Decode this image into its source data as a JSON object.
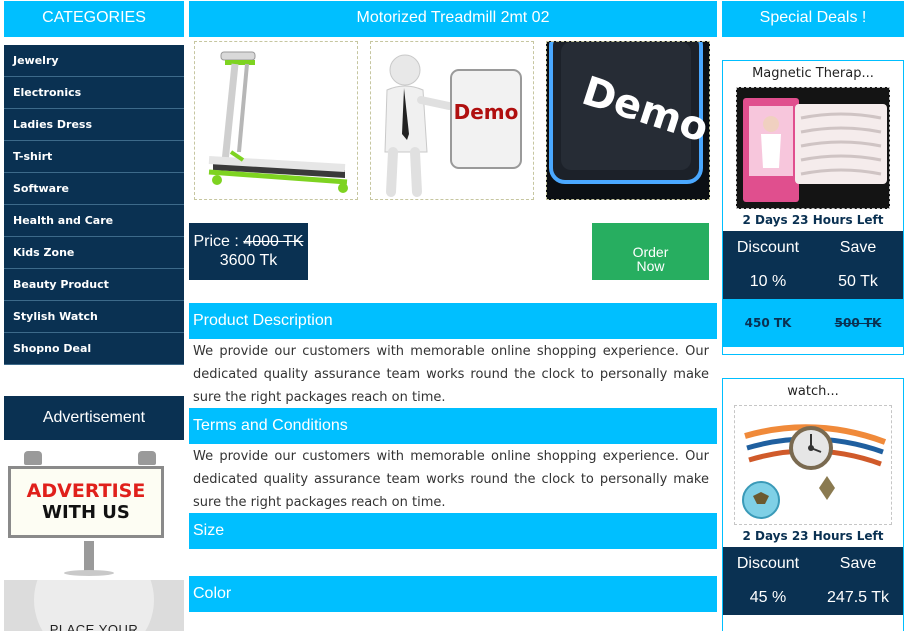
{
  "categories": {
    "title": "CATEGORIES",
    "items": [
      {
        "label": "Jewelry"
      },
      {
        "label": "Electronics"
      },
      {
        "label": "Ladies Dress"
      },
      {
        "label": "T-shirt"
      },
      {
        "label": "Software"
      },
      {
        "label": "Health and Care"
      },
      {
        "label": "Kids Zone"
      },
      {
        "label": "Beauty Product"
      },
      {
        "label": "Stylish Watch"
      },
      {
        "label": "Shopno Deal"
      }
    ]
  },
  "advertisement": {
    "title": "Advertisement",
    "board_line1": "ADVERTISE",
    "board_line2": "WITH US",
    "place_text": "PLACE YOUR"
  },
  "product": {
    "title": "Motorized Treadmill 2mt 02",
    "demo_label_1": "Demo",
    "demo_label_2": "Demo",
    "price_label": "Price :",
    "old_price": "4000 TK",
    "new_price": "3600 Tk",
    "order_line1": "Order",
    "order_line2": "Now"
  },
  "sections": {
    "description_title": "Product Description",
    "description_text": "We provide our customers with memorable online shopping experience. Our dedicated quality assurance team works round the clock to personally make sure the right packages reach on time.",
    "terms_title": "Terms and Conditions",
    "terms_text": "We provide our customers with memorable online shopping experience. Our dedicated quality assurance team works round the clock to personally make sure the right packages reach on time.",
    "size_title": "Size",
    "color_title": "Color"
  },
  "deals": {
    "title": "Special Deals !",
    "items": [
      {
        "name": "Magnetic Therap...",
        "timer": "2 Days 23 Hours Left",
        "discount_label": "Discount",
        "save_label": "Save",
        "discount": "10 %",
        "save": "50 Tk",
        "new_price": "450 TK",
        "old_price": "500 TK"
      },
      {
        "name": "watch...",
        "timer": "2 Days 23 Hours Left",
        "discount_label": "Discount",
        "save_label": "Save",
        "discount": "45 %",
        "save": "247.5 Tk"
      }
    ]
  },
  "colors": {
    "accent": "#00bfff",
    "navy": "#0a3152",
    "order_green": "#27ae60"
  }
}
